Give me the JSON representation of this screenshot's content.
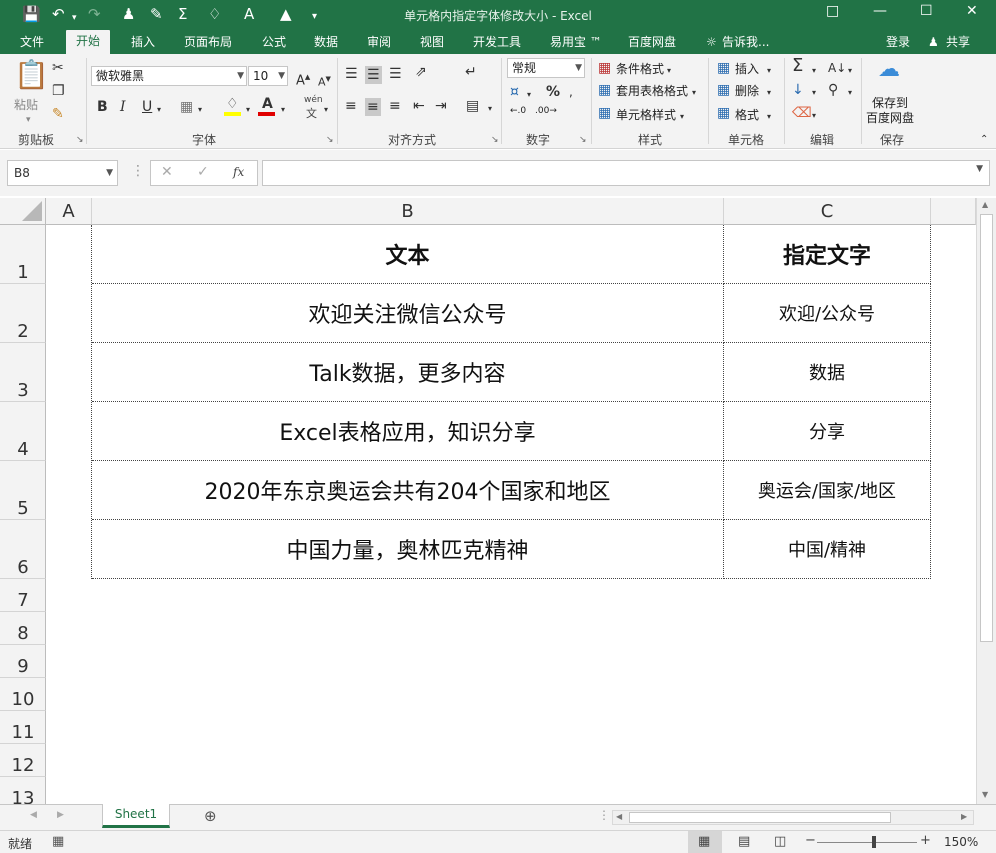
{
  "window": {
    "title": "单元格内指定字体修改大小 - Excel"
  },
  "ribbon_tabs": [
    "文件",
    "开始",
    "插入",
    "页面布局",
    "公式",
    "数据",
    "审阅",
    "视图",
    "开发工具",
    "易用宝 ™",
    "百度网盘"
  ],
  "tell_me": "告诉我...",
  "login": "登录",
  "share": "共享",
  "clipboard": {
    "paste": "粘贴",
    "label": "剪贴板"
  },
  "font_group": {
    "font_name": "微软雅黑",
    "font_size": "10",
    "label": "字体",
    "bold": "B",
    "italic": "I",
    "underline": "U",
    "wen": "wén",
    "wen2": "文"
  },
  "align_group": {
    "label": "对齐方式"
  },
  "number_group": {
    "format": "常规",
    "label": "数字",
    "percent": "%"
  },
  "styles_group": {
    "cond": "条件格式",
    "table": "套用表格格式",
    "cell": "单元格样式",
    "label": "样式"
  },
  "cells_group": {
    "insert": "插入",
    "delete": "删除",
    "format": "格式",
    "label": "单元格"
  },
  "edit_group": {
    "label": "编辑"
  },
  "save_group": {
    "btn1": "保存到",
    "btn2": "百度网盘",
    "label": "保存"
  },
  "name_box": "B8",
  "fx": "fx",
  "columns": [
    "A",
    "B",
    "C"
  ],
  "rows": [
    "1",
    "2",
    "3",
    "4",
    "5",
    "6",
    "7",
    "8",
    "9",
    "10",
    "11",
    "12",
    "13"
  ],
  "table": [
    {
      "b": "文本",
      "c": "指定文字"
    },
    {
      "b": "欢迎关注微信公众号",
      "c": "欢迎/公众号"
    },
    {
      "b": "Talk数据，更多内容",
      "c": "数据"
    },
    {
      "b": "Excel表格应用，知识分享",
      "c": "分享"
    },
    {
      "b": "2020年东京奥运会共有204个国家和地区",
      "c": "奥运会/国家/地区"
    },
    {
      "b": "中国力量，奥林匹克精神",
      "c": "中国/精神"
    }
  ],
  "sheet_tab": "Sheet1",
  "status": {
    "ready": "就绪",
    "zoom": "150%"
  },
  "colors": {
    "accent": "#217346"
  }
}
